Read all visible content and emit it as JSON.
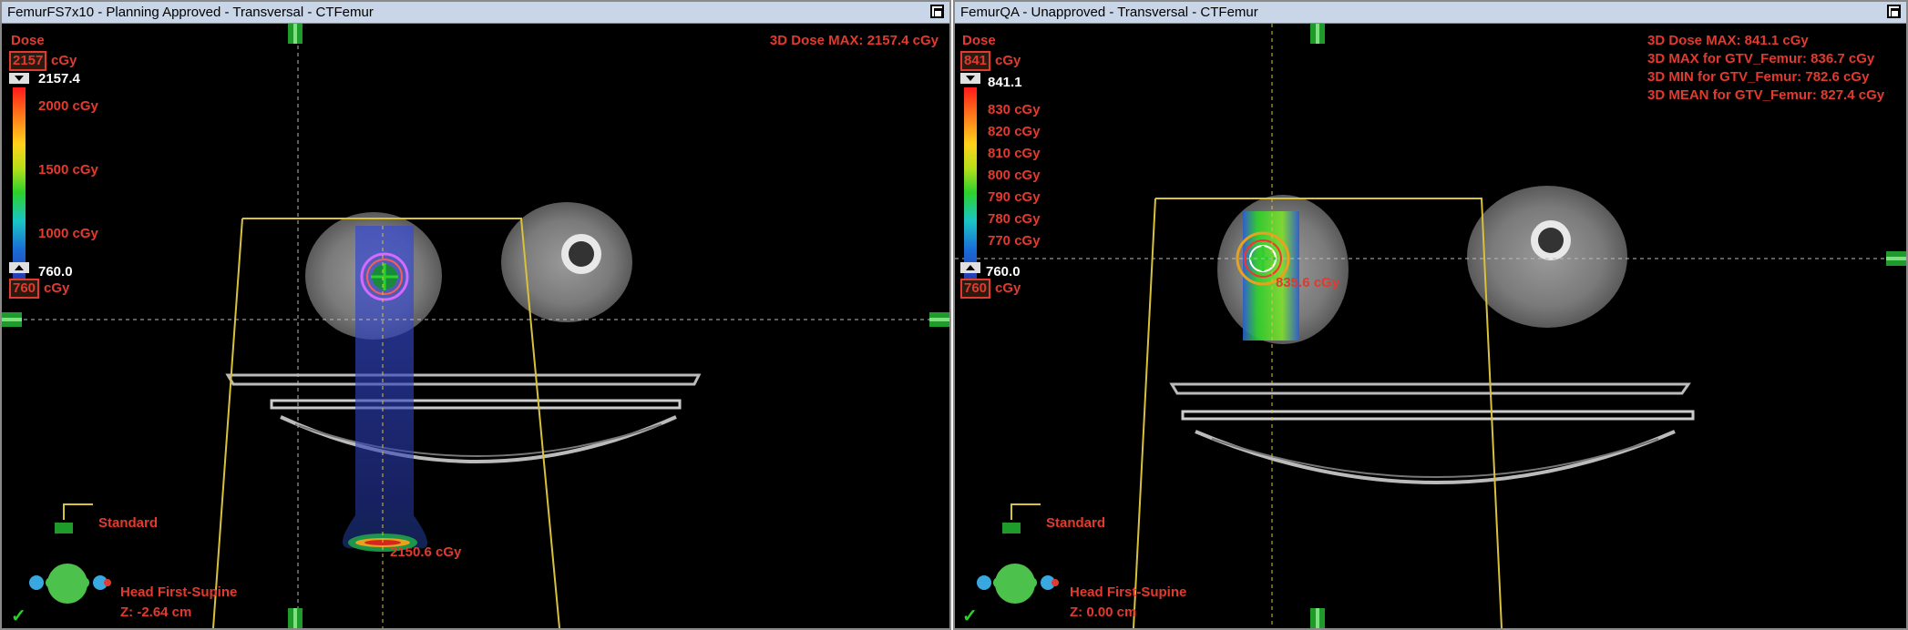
{
  "panels": [
    {
      "title": "FemurFS7x10  -  Planning Approved - Transversal - CTFemur",
      "dose_label": "Dose",
      "upper_box": "2157",
      "upper_unit": "cGy",
      "upper_value": "2157.4",
      "scale_ticks": [
        "2000 cGy",
        "1500 cGy",
        "1000 cGy"
      ],
      "lower_value": "760.0",
      "lower_box": "760",
      "lower_unit": "cGy",
      "info_lines": [
        "3D Dose MAX: 2157.4 cGy"
      ],
      "point_dose": "2150.6 cGy",
      "orientation_label": "Standard",
      "patient_position": "Head First-Supine",
      "z_position": "Z: -2.64 cm",
      "approved_check": "✓"
    },
    {
      "title": "FemurQA  -  Unapproved - Transversal - CTFemur",
      "dose_label": "Dose",
      "upper_box": "841",
      "upper_unit": "cGy",
      "upper_value": "841.1",
      "scale_ticks": [
        "830 cGy",
        "820 cGy",
        "810 cGy",
        "800 cGy",
        "790 cGy",
        "780 cGy",
        "770 cGy"
      ],
      "lower_value": "760.0",
      "lower_box": "760",
      "lower_unit": "cGy",
      "info_lines": [
        "3D Dose MAX: 841.1 cGy",
        "3D MAX for GTV_Femur: 836.7 cGy",
        "3D MIN for GTV_Femur: 782.6 cGy",
        "3D MEAN for GTV_Femur: 827.4 cGy"
      ],
      "point_dose": "835.6 cGy",
      "orientation_label": "Standard",
      "patient_position": "Head First-Supine",
      "z_position": "Z: 0.00 cm",
      "approved_check": "✓"
    }
  ],
  "colors": {
    "label_red": "#e23a2e",
    "titlebar": "#c9d6e8",
    "field_yellow": "#d8c23a",
    "marker_green": "#1e9b2a"
  }
}
